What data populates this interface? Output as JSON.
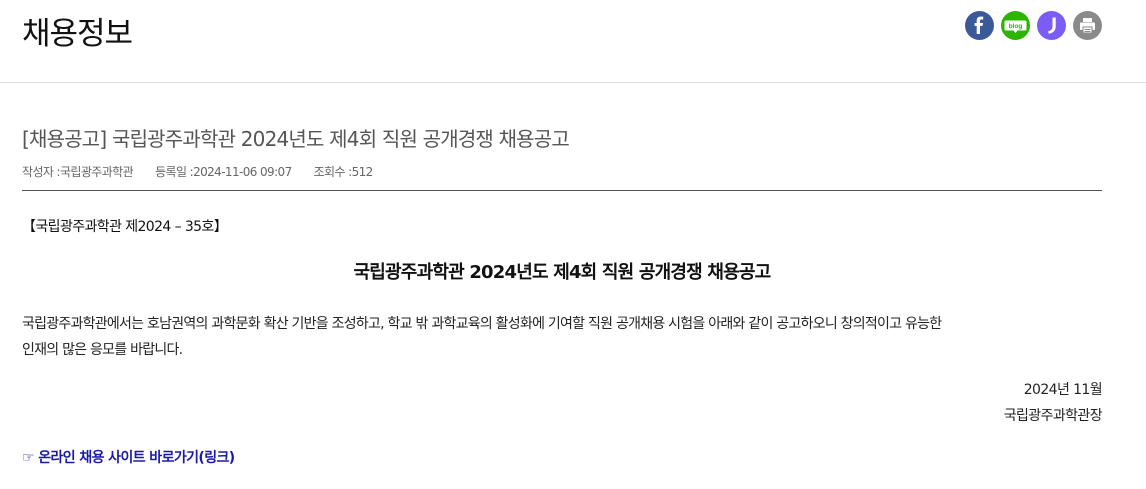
{
  "header": {
    "title": "채용정보",
    "share": {
      "facebook_color": "#3b5998",
      "blog_color": "#2db400",
      "story_color": "#7b5cf5",
      "print_color": "#8a8a8a",
      "blog_label": "blog"
    }
  },
  "post": {
    "title": "[채용공고] 국립광주과학관 2024년도 제4회 직원 공개경쟁 채용공고",
    "meta": {
      "author_label": "작성자 : ",
      "author": "국립광주과학관",
      "date_label": "등록일 : ",
      "date": "2024-11-06 09:07",
      "views_label": "조회수 : ",
      "views": "512"
    }
  },
  "content": {
    "notice_no": "【국립광주과학관 제2024 – 35호】",
    "heading": "국립광주과학관 2024년도 제4회 직원 공개경쟁 채용공고",
    "paragraph_line1": "국립광주과학관에서는 호남권역의 과학문화 확산 기반을 조성하고, 학교 밖 과학교육의 활성화에 기여할 직원 공개채용 시험을 아래와 같이 공고하오니 창의적이고 유능한",
    "paragraph_line2": "인재의 많은 응모를 바랍니다.",
    "sign_date": "2024년 11월",
    "sign_org": "국립광주과학관장",
    "link_text": "☞ 온라인 채용 사이트 바로가기(링크)"
  }
}
